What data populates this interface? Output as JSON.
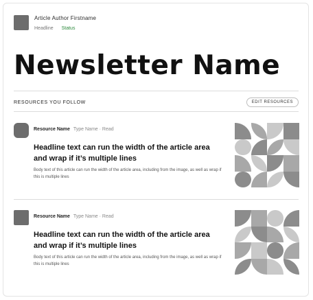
{
  "author": {
    "name": "Article Author Firstname",
    "meta": "Headline",
    "status": "Status"
  },
  "newsletter": {
    "title": "Newsletter Name"
  },
  "resources": {
    "label": "RESOURCES YOU FOLLOW",
    "follow_button": "EDIT RESOURCES"
  },
  "items": [
    {
      "source_name": "Resource Name",
      "source_meta": "Type Name · Read",
      "headline": "Headline text can run the width of the article area and wrap if it’s multiple lines",
      "body": "Body text of this article can run the width of the article area, including from the image, as well as wrap if this is multiple lines"
    },
    {
      "source_name": "Resource Name",
      "source_meta": "Type Name · Read",
      "headline": "Headline text can run the width of the article area and wrap if it’s multiple lines",
      "body": "Body text of this article can run the width of the article area, including from the image, as well as wrap if this is multiple lines"
    }
  ],
  "colors": {
    "avatar": "#6d6d6d",
    "status": "#2e8a3e",
    "mosaic_dark": "#8c8c8c",
    "mosaic_mid": "#a8a8a8",
    "mosaic_light": "#c9c9c9"
  }
}
